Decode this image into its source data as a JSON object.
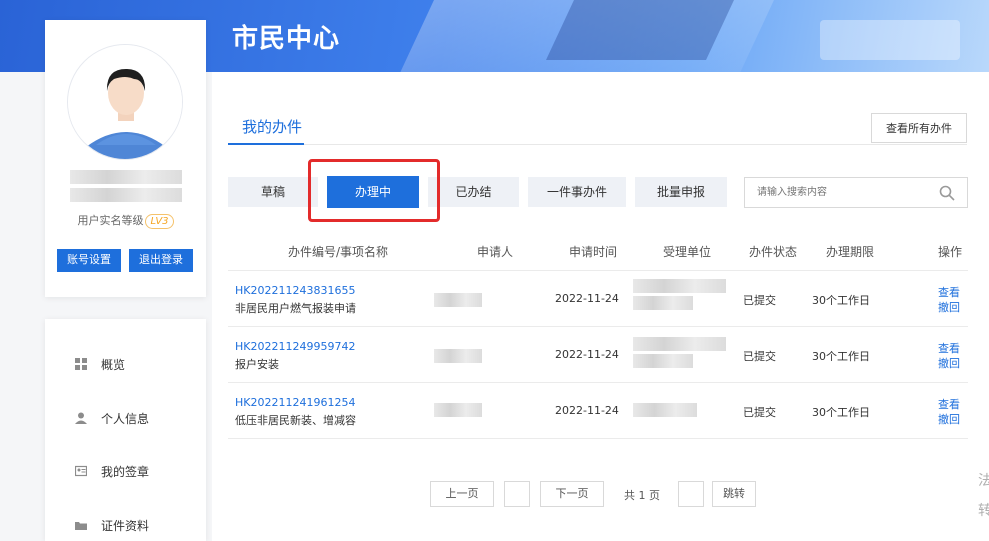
{
  "header": {
    "title": "市民中心"
  },
  "profile": {
    "level_label": "用户实名等级",
    "level_badge": "LV3",
    "settings_button": "账号设置",
    "logout_button": "退出登录"
  },
  "menu": {
    "items": [
      {
        "label": "概览",
        "icon": "grid-icon"
      },
      {
        "label": "个人信息",
        "icon": "user-icon"
      },
      {
        "label": "我的签章",
        "icon": "id-card-icon"
      },
      {
        "label": "证件资料",
        "icon": "folder-icon"
      }
    ]
  },
  "main": {
    "tab_title": "我的办件",
    "view_all_button": "查看所有办件",
    "status_tabs": [
      "草稿",
      "办理中",
      "已办结",
      "一件事办件",
      "批量申报"
    ],
    "active_tab": "办理中",
    "search": {
      "placeholder": "请输入搜索内容"
    },
    "table": {
      "headers": [
        "办件编号/事项名称",
        "申请人",
        "申请时间",
        "受理单位",
        "办件状态",
        "办理期限",
        "操作"
      ],
      "rows": [
        {
          "code": "HK202211243831655",
          "name": "非居民用户燃气报装申请",
          "date": "2022-11-24",
          "status": "已提交",
          "deadline": "30个工作日",
          "op_view": "查看",
          "op_withdraw": "撤回"
        },
        {
          "code": "HK202211249959742",
          "name": "报户安装",
          "date": "2022-11-24",
          "status": "已提交",
          "deadline": "30个工作日",
          "op_view": "查看",
          "op_withdraw": "撤回"
        },
        {
          "code": "HK202211241961254",
          "name": "低压非居民新装、增减容",
          "date": "2022-11-24",
          "status": "已提交",
          "deadline": "30个工作日",
          "op_view": "查看",
          "op_withdraw": "撤回"
        }
      ]
    },
    "pagination": {
      "prev": "上一页",
      "next": "下一页",
      "total_pages": "共 1 页",
      "jump": "跳转"
    }
  },
  "edge_text": [
    "法",
    "转"
  ],
  "colors": {
    "primary": "#1e6fdc",
    "highlight": "#e32b2b",
    "badge": "#f5a623"
  }
}
